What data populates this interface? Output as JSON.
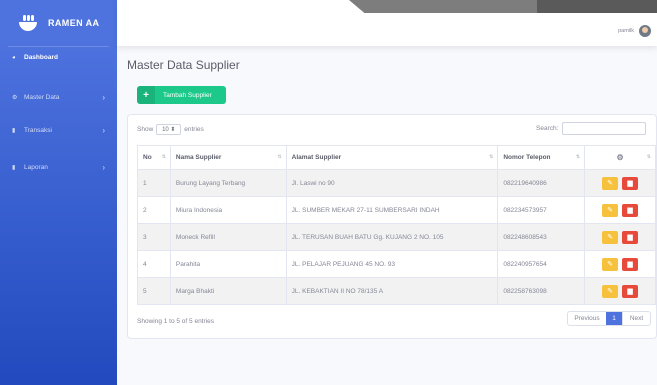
{
  "sidebar": {
    "brand": "RAMEN AA",
    "items": [
      {
        "label": "Dashboard"
      },
      {
        "label": "Master Data"
      },
      {
        "label": "Transaksi"
      },
      {
        "label": "Laporan"
      }
    ]
  },
  "topbar": {
    "user_name": "pamilk"
  },
  "page": {
    "title": "Master Data Supplier",
    "add_button": "Tambah Supplier",
    "show_label": "Show",
    "entries_value": "10",
    "entries_label": "entries",
    "search_label": "Search:",
    "columns": [
      "No",
      "Nama Supplier",
      "Alamat Supplier",
      "Nomor Telepon"
    ],
    "rows": [
      {
        "no": "1",
        "nama": "Burung Layang Terbang",
        "alamat": "Jl. Laswi no 90",
        "telp": "082219640986"
      },
      {
        "no": "2",
        "nama": "Miura Indonesia",
        "alamat": "JL. SUMBER MEKAR 27-11 SUMBERSARI INDAH",
        "telp": "082234573957"
      },
      {
        "no": "3",
        "nama": "Moneck Refill",
        "alamat": "JL. TERUSAN BUAH BATU Gg. KUJANG 2 NO. 105",
        "telp": "082248608543"
      },
      {
        "no": "4",
        "nama": "Parahita",
        "alamat": "JL. PELAJAR PEJUANG 45 NO. 93",
        "telp": "082240957654"
      },
      {
        "no": "5",
        "nama": "Marga Bhakti",
        "alamat": "JL. KEBAKTIAN II NO 78/135 A",
        "telp": "082258763098"
      }
    ],
    "info": "Showing 1 to 5 of 5 entries",
    "pager": {
      "prev": "Previous",
      "current": "1",
      "next": "Next"
    }
  },
  "colors": {
    "primary": "#4e73df",
    "success": "#1cc88a",
    "warning": "#f6c23e",
    "danger": "#e74a3b"
  }
}
